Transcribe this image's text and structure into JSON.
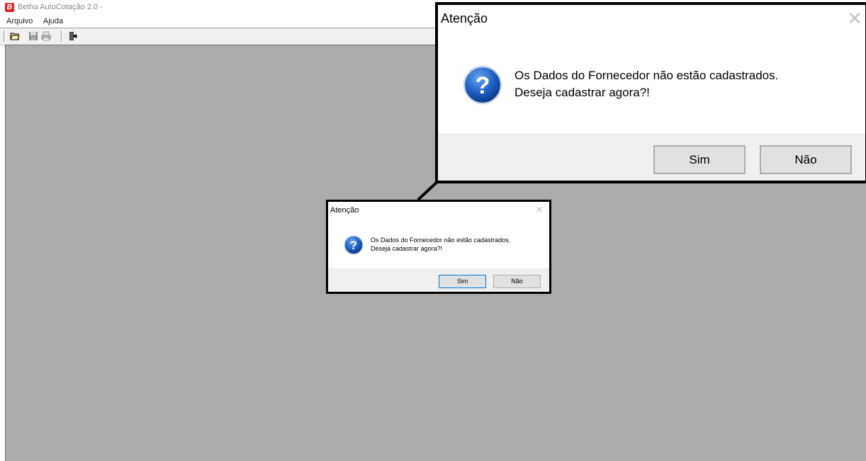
{
  "window": {
    "logo_letter": "B",
    "title": "Betha AutoCotação 2.0 -",
    "accent_color": "#e11f26"
  },
  "menu": {
    "items": [
      {
        "label": "Arquivo"
      },
      {
        "label": "Ajuda"
      }
    ]
  },
  "toolbar": {
    "buttons": [
      {
        "icon": "open-folder-icon",
        "enabled": true
      },
      {
        "icon": "save-icon",
        "enabled": false
      },
      {
        "icon": "print-icon",
        "enabled": false
      },
      {
        "icon": "exit-door-icon",
        "enabled": true
      }
    ]
  },
  "workspace": {
    "background": "#ababab"
  },
  "dialog": {
    "title": "Atenção",
    "close_glyph": "✕",
    "icon": "question-icon",
    "message_line1": "Os Dados do Fornecedor não estão cadastrados.",
    "message_line2": "Deseja cadastrar agora?!",
    "yes_label": "Sim",
    "no_label": "Não"
  }
}
